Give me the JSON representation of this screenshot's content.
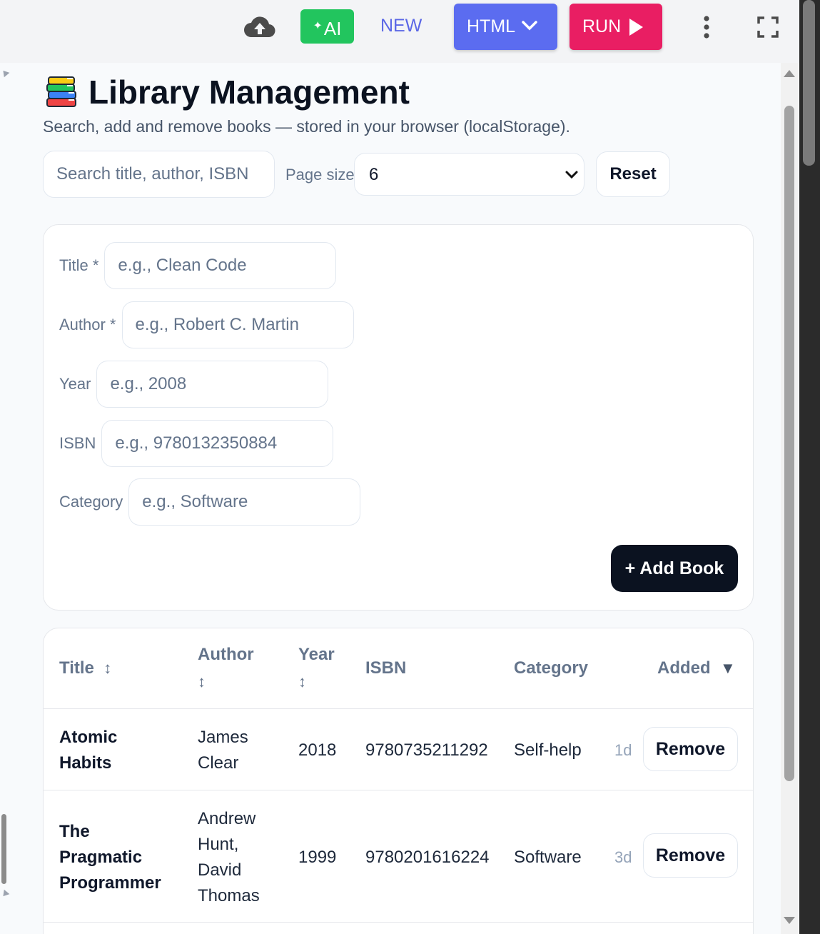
{
  "toolbar": {
    "upload_icon": "cloud-upload-icon",
    "ai_label": "AI",
    "new_label": "NEW",
    "html_label": "HTML",
    "run_label": "RUN",
    "colors": {
      "ai": "#22c55e",
      "html": "#5b6cf0",
      "run": "#e91e63",
      "new": "#5b67e6"
    }
  },
  "header": {
    "title": "Library Management",
    "subtitle": "Search, add and remove books — stored in your browser (localStorage).",
    "icon": "books-icon"
  },
  "controls": {
    "search_placeholder": "Search title, author, ISBN",
    "page_size_label": "Page size",
    "page_size_value": "6",
    "reset_label": "Reset"
  },
  "form": {
    "title_label": "Title *",
    "title_placeholder": "e.g., Clean Code",
    "author_label": "Author *",
    "author_placeholder": "e.g., Robert C. Martin",
    "year_label": "Year",
    "year_placeholder": "e.g., 2008",
    "isbn_label": "ISBN",
    "isbn_placeholder": "e.g., 9780132350884",
    "category_label": "Category",
    "category_placeholder": "e.g., Software",
    "add_label": "+ Add Book"
  },
  "table": {
    "headers": {
      "title": "Title",
      "author": "Author",
      "year": "Year",
      "isbn": "ISBN",
      "category": "Category",
      "added": "Added"
    },
    "sort_glyph": "↕",
    "sort_active_glyph": "▼",
    "remove_label": "Remove",
    "rows": [
      {
        "title": "Atomic Habits",
        "author": "James Clear",
        "year": "2018",
        "isbn": "9780735211292",
        "category": "Self-help",
        "added": "1d"
      },
      {
        "title": "The Pragmatic Programmer",
        "author": "Andrew Hunt, David Thomas",
        "year": "1999",
        "isbn": "9780201616224",
        "category": "Software",
        "added": "3d"
      }
    ]
  }
}
